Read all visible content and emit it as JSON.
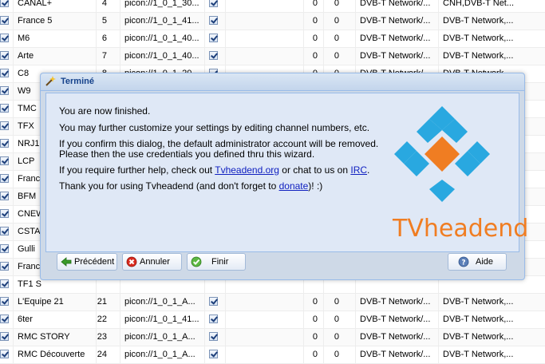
{
  "channels": [
    {
      "name": "CANAL+",
      "number": "4",
      "picon": "picon://1_0_1_30...",
      "zero1": "0",
      "zero2": "0",
      "network": "DVB-T Network/...",
      "service": "CNH,DVB-T Net..."
    },
    {
      "name": "France 5",
      "number": "5",
      "picon": "picon://1_0_1_41...",
      "zero1": "0",
      "zero2": "0",
      "network": "DVB-T Network/...",
      "service": "DVB-T Network,..."
    },
    {
      "name": "M6",
      "number": "6",
      "picon": "picon://1_0_1_40...",
      "zero1": "0",
      "zero2": "0",
      "network": "DVB-T Network/...",
      "service": "DVB-T Network,..."
    },
    {
      "name": "Arte",
      "number": "7",
      "picon": "picon://1_0_1_40...",
      "zero1": "0",
      "zero2": "0",
      "network": "DVB-T Network/...",
      "service": "DVB-T Network,..."
    },
    {
      "name": "C8",
      "number": "8",
      "picon": "picon://1_0_1_20...",
      "zero1": "0",
      "zero2": "0",
      "network": "DVB-T Network/...",
      "service": "DVB-T Network,..."
    },
    {
      "name": "W9",
      "number": "",
      "picon": "",
      "zero1": "",
      "zero2": "",
      "network": "",
      "service": ""
    },
    {
      "name": "TMC",
      "number": "",
      "picon": "",
      "zero1": "",
      "zero2": "",
      "network": "",
      "service": ""
    },
    {
      "name": "TFX",
      "number": "",
      "picon": "",
      "zero1": "",
      "zero2": "",
      "network": "",
      "service": ""
    },
    {
      "name": "NRJ1",
      "number": "",
      "picon": "",
      "zero1": "",
      "zero2": "",
      "network": "",
      "service": ""
    },
    {
      "name": "LCP",
      "number": "",
      "picon": "",
      "zero1": "",
      "zero2": "",
      "network": "",
      "service": ""
    },
    {
      "name": "Franc",
      "number": "",
      "picon": "",
      "zero1": "",
      "zero2": "",
      "network": "",
      "service": ""
    },
    {
      "name": "BFM",
      "number": "",
      "picon": "",
      "zero1": "",
      "zero2": "",
      "network": "",
      "service": ""
    },
    {
      "name": "CNEW",
      "number": "",
      "picon": "",
      "zero1": "",
      "zero2": "",
      "network": "",
      "service": ""
    },
    {
      "name": "CSTA",
      "number": "",
      "picon": "",
      "zero1": "",
      "zero2": "",
      "network": "",
      "service": ""
    },
    {
      "name": "Gulli",
      "number": "",
      "picon": "",
      "zero1": "",
      "zero2": "",
      "network": "",
      "service": ""
    },
    {
      "name": "Franc",
      "number": "",
      "picon": "",
      "zero1": "",
      "zero2": "",
      "network": "",
      "service": ""
    },
    {
      "name": "TF1 S",
      "number": "",
      "picon": "",
      "zero1": "",
      "zero2": "",
      "network": "",
      "service": ""
    },
    {
      "name": "L'Equipe 21",
      "number": "21",
      "picon": "picon://1_0_1_A...",
      "zero1": "0",
      "zero2": "0",
      "network": "DVB-T Network/...",
      "service": "DVB-T Network,..."
    },
    {
      "name": "6ter",
      "number": "22",
      "picon": "picon://1_0_1_41...",
      "zero1": "0",
      "zero2": "0",
      "network": "DVB-T Network/...",
      "service": "DVB-T Network,..."
    },
    {
      "name": "RMC STORY",
      "number": "23",
      "picon": "picon://1_0_1_A...",
      "zero1": "0",
      "zero2": "0",
      "network": "DVB-T Network/...",
      "service": "DVB-T Network,..."
    },
    {
      "name": "RMC Découverte",
      "number": "24",
      "picon": "picon://1_0_1_A...",
      "zero1": "0",
      "zero2": "0",
      "network": "DVB-T Network/...",
      "service": "DVB-T Network,..."
    }
  ],
  "dialog": {
    "title": "Terminé",
    "line1": "You are now finished.",
    "line2": "You may further customize your settings by editing channel numbers, etc.",
    "line3a": "If you confirm this dialog, the default administrator account will be removed.",
    "line3b": "Please then the use credentials you defined thru this wizard.",
    "help_prefix": "If you require further help, check out ",
    "help_link1": "Tvheadend.org",
    "help_middle": " or chat to us on ",
    "help_link2": "IRC",
    "help_suffix": ".",
    "thanks_prefix": "Thank you for using Tvheadend (and don't forget to ",
    "thanks_link": "donate",
    "thanks_suffix": ")! :)",
    "logo_text": "TVheadend",
    "logo_colors": {
      "blue": "#29a8e0",
      "orange": "#f07d22"
    },
    "buttons": {
      "previous": "Précédent",
      "cancel": "Annuler",
      "finish": "Finir",
      "help": "Aide"
    }
  }
}
